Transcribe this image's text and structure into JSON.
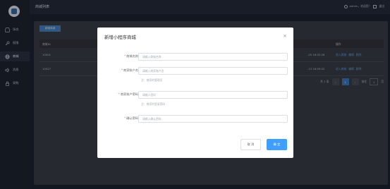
{
  "sidebar": {
    "items": [
      {
        "label": "场合",
        "icon": "shop-icon"
      },
      {
        "label": "权限",
        "icon": "key-icon"
      },
      {
        "label": "商城",
        "icon": "globe-icon"
      },
      {
        "label": "消息",
        "icon": "speaker-icon"
      },
      {
        "label": "采购",
        "icon": "lock-icon"
      }
    ]
  },
  "header": {
    "title": "商城列表",
    "user": "admin，欢迎您！",
    "logout": "退出"
  },
  "toolbar": {
    "add_label": "新增商城"
  },
  "table": {
    "columns": [
      "商城ID",
      "",
      "操作"
    ],
    "rows": [
      {
        "id": "10001",
        "time": "-25 16:32:26",
        "actions": [
          "进入商城",
          "编辑",
          "删除"
        ]
      },
      {
        "id": "10027",
        "time": "-13 16:59:02",
        "actions": [
          "进入商城",
          "编辑",
          "删除"
        ]
      }
    ]
  },
  "pager": {
    "total": "共 2 条",
    "page": "1",
    "goto": "前往",
    "goto_value": "1",
    "page_unit": "页",
    "prev": "‹",
    "next": "›"
  },
  "modal": {
    "title": "新增小程序商城",
    "close": "×",
    "fields": [
      {
        "label": "商城名称",
        "placeholder": "请输入商城名称",
        "hint": ""
      },
      {
        "label": "商家账户名",
        "placeholder": "请输入商家账户名",
        "hint": "注：商家的管理员"
      },
      {
        "label": "商家账户密码",
        "placeholder": "请输入密码",
        "hint": "注：商家的登录密码"
      },
      {
        "label": "确认密码",
        "placeholder": "请输入确认密码",
        "hint": ""
      }
    ],
    "cancel_label": "取 消",
    "ok_label": "确 定"
  }
}
